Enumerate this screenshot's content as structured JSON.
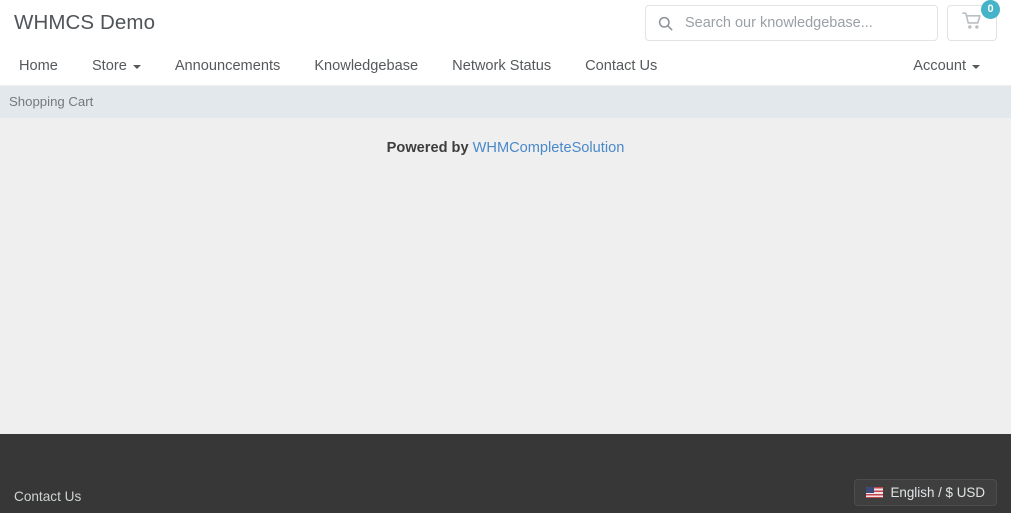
{
  "header": {
    "brand": "WHMCS Demo",
    "search": {
      "placeholder": "Search our knowledgebase...",
      "value": "",
      "icon": "search-icon"
    },
    "cart": {
      "icon": "shopping-cart-icon",
      "badge_count": "0",
      "badge_color": "#45b3c8"
    }
  },
  "nav": {
    "items": [
      {
        "label": "Home",
        "has_caret": false
      },
      {
        "label": "Store",
        "has_caret": true
      },
      {
        "label": "Announcements",
        "has_caret": false
      },
      {
        "label": "Knowledgebase",
        "has_caret": false
      },
      {
        "label": "Network Status",
        "has_caret": false
      },
      {
        "label": "Contact Us",
        "has_caret": false
      }
    ],
    "account": {
      "label": "Account",
      "has_caret": true
    }
  },
  "breadcrumb": {
    "items": [
      {
        "label": "Shopping Cart"
      }
    ]
  },
  "main": {
    "powered_by_prefix": "Powered by ",
    "powered_by_link": "WHMCompleteSolution",
    "link_color": "#4a89c8"
  },
  "footer": {
    "contact_link": "Contact Us",
    "language_button": {
      "label": "English / $ USD",
      "icon": "us-flag-icon"
    },
    "background_color": "#373737"
  }
}
